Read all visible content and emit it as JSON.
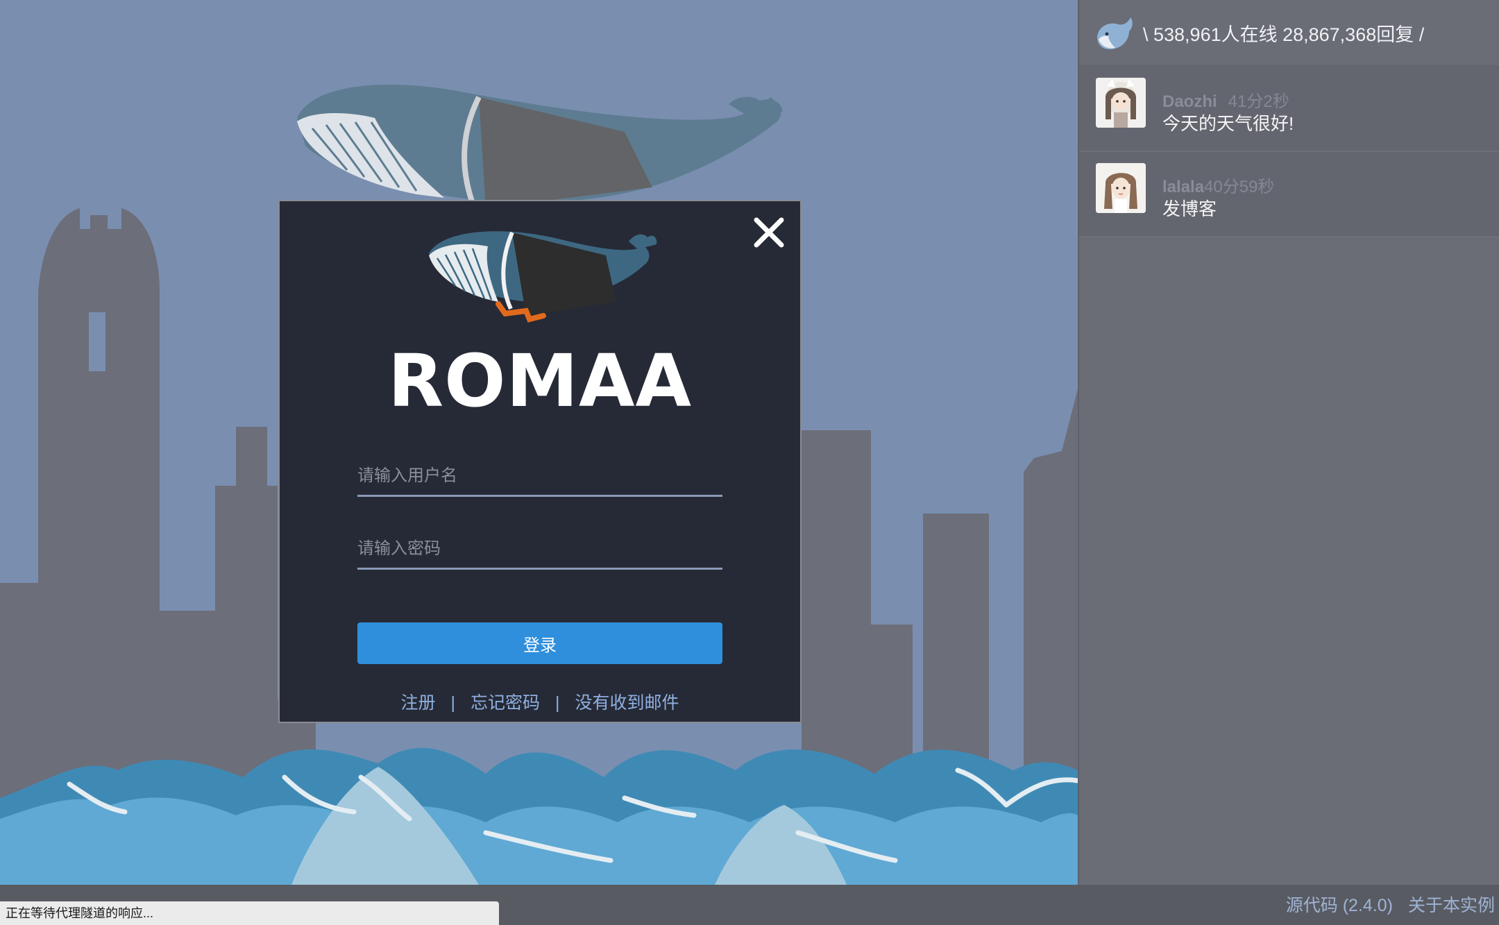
{
  "modal": {
    "title": "ROMAA",
    "username_placeholder": "请输入用户名",
    "password_placeholder": "请输入密码",
    "login_label": "登录",
    "links": {
      "register": "注册",
      "forgot": "忘记密码",
      "no_email": "没有收到邮件",
      "separator": "|"
    }
  },
  "stats": {
    "text": "\\ 538,961人在线 28,867,368回复 /"
  },
  "feed": [
    {
      "user": "Daozhi",
      "time": "41分2秒",
      "message": "今天的天气很好!"
    },
    {
      "user": "lalala",
      "time": "40分59秒",
      "message": "发博客"
    }
  ],
  "footer": {
    "status": "正在等待代理隧道的响应...",
    "source_label": "源代码 (2.4.0)",
    "about_label": "关于本实例"
  },
  "colors": {
    "sky": "#7a8fb0",
    "city": "#6c6e7a",
    "modal_bg": "#262a36",
    "primary": "#2f8fdc",
    "link": "#8fb0e0"
  }
}
